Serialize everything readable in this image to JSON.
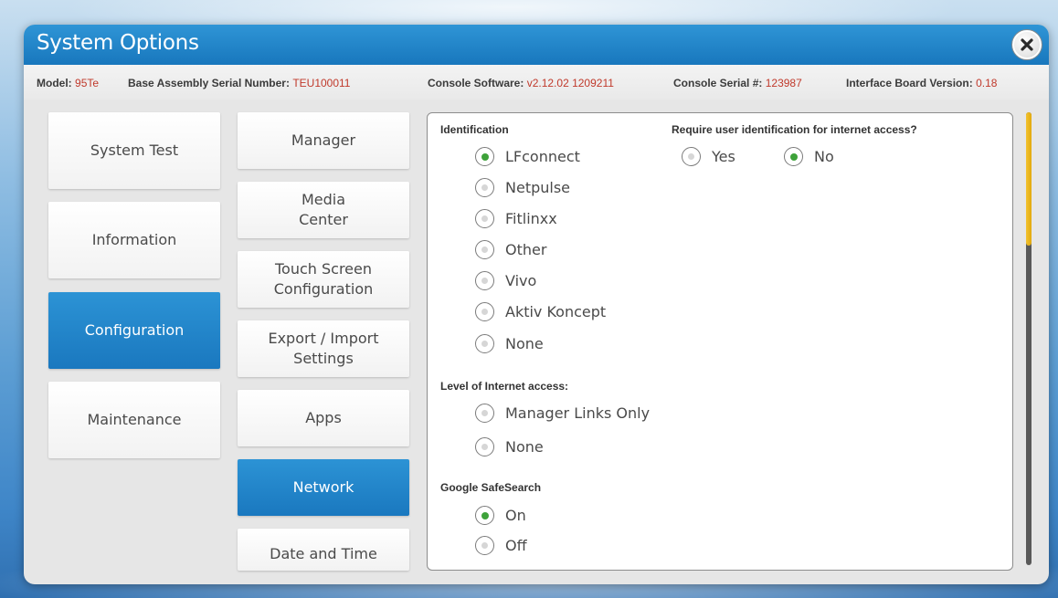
{
  "window": {
    "title": "System Options"
  },
  "info": {
    "model_label": "Model:",
    "model_value": "95Te",
    "base_label": "Base Assembly Serial Number:",
    "base_value": "TEU100011",
    "console_sw_label": "Console Software:",
    "console_sw_value": "v2.12.02 1209211",
    "console_serial_label": "Console Serial #:",
    "console_serial_value": "123987",
    "interface_label": "Interface Board Version:",
    "interface_value": "0.18"
  },
  "nav_main": [
    {
      "label": "System Test",
      "active": false
    },
    {
      "label": "Information",
      "active": false
    },
    {
      "label": "Configuration",
      "active": true
    },
    {
      "label": "Maintenance",
      "active": false
    }
  ],
  "nav_sub": [
    {
      "label": "Manager",
      "active": false
    },
    {
      "label": "Media\nCenter",
      "active": false
    },
    {
      "label": "Touch Screen\nConfiguration",
      "active": false
    },
    {
      "label": "Export / Import\nSettings",
      "active": false
    },
    {
      "label": "Apps",
      "active": false
    },
    {
      "label": "Network",
      "active": true
    },
    {
      "label": "Date and Time",
      "active": false
    }
  ],
  "identification": {
    "label": "Identification",
    "options": [
      {
        "label": "LFconnect",
        "checked": true
      },
      {
        "label": "Netpulse",
        "checked": false
      },
      {
        "label": "Fitlinxx",
        "checked": false
      },
      {
        "label": "Other",
        "checked": false
      },
      {
        "label": "Vivo",
        "checked": false
      },
      {
        "label": "Aktiv Koncept",
        "checked": false
      },
      {
        "label": "None",
        "checked": false
      }
    ]
  },
  "require_id": {
    "label": "Require user identification for internet access?",
    "options": [
      {
        "label": "Yes",
        "checked": false
      },
      {
        "label": "No",
        "checked": true
      }
    ]
  },
  "internet_level": {
    "label": "Level of Internet access:",
    "options": [
      {
        "label": "Manager Links Only",
        "checked": false
      },
      {
        "label": "None",
        "checked": false
      }
    ]
  },
  "safesearch": {
    "label": "Google SafeSearch",
    "options": [
      {
        "label": "On",
        "checked": true
      },
      {
        "label": "Off",
        "checked": false
      }
    ]
  },
  "colors": {
    "accent": "#1a78bf",
    "value_red": "#c0392b",
    "radio_checked": "#3ea23a",
    "scroll_thumb": "#e2a90d"
  }
}
